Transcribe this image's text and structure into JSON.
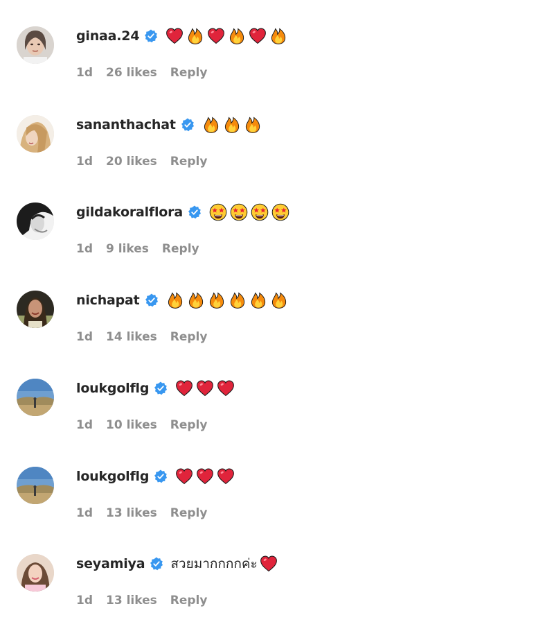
{
  "comments": [
    {
      "username": "ginaa.24",
      "verified": true,
      "content": [
        {
          "type": "emoji",
          "name": "heart"
        },
        {
          "type": "emoji",
          "name": "fire"
        },
        {
          "type": "emoji",
          "name": "heart"
        },
        {
          "type": "emoji",
          "name": "fire"
        },
        {
          "type": "emoji",
          "name": "heart"
        },
        {
          "type": "emoji",
          "name": "fire"
        }
      ],
      "time": "1d",
      "likes": "26 likes",
      "reply": "Reply",
      "avatar": "avatar-woman-light"
    },
    {
      "username": "sananthachat",
      "verified": true,
      "content": [
        {
          "type": "emoji",
          "name": "fire"
        },
        {
          "type": "emoji",
          "name": "fire"
        },
        {
          "type": "emoji",
          "name": "fire"
        }
      ],
      "time": "1d",
      "likes": "20 likes",
      "reply": "Reply",
      "avatar": "avatar-woman-blonde"
    },
    {
      "username": "gildakoralflora",
      "verified": true,
      "content": [
        {
          "type": "emoji",
          "name": "star-struck"
        },
        {
          "type": "emoji",
          "name": "star-struck"
        },
        {
          "type": "emoji",
          "name": "star-struck"
        },
        {
          "type": "emoji",
          "name": "star-struck"
        }
      ],
      "time": "1d",
      "likes": "9 likes",
      "reply": "Reply",
      "avatar": "avatar-bw-portrait"
    },
    {
      "username": "nichapat",
      "verified": true,
      "content": [
        {
          "type": "emoji",
          "name": "fire"
        },
        {
          "type": "emoji",
          "name": "fire"
        },
        {
          "type": "emoji",
          "name": "fire"
        },
        {
          "type": "emoji",
          "name": "fire"
        },
        {
          "type": "emoji",
          "name": "fire"
        },
        {
          "type": "emoji",
          "name": "fire"
        }
      ],
      "time": "1d",
      "likes": "14 likes",
      "reply": "Reply",
      "avatar": "avatar-woman-dark"
    },
    {
      "username": "loukgolflg",
      "verified": true,
      "content": [
        {
          "type": "emoji",
          "name": "heart"
        },
        {
          "type": "emoji",
          "name": "heart"
        },
        {
          "type": "emoji",
          "name": "heart"
        }
      ],
      "time": "1d",
      "likes": "10 likes",
      "reply": "Reply",
      "avatar": "avatar-landscape"
    },
    {
      "username": "loukgolflg",
      "verified": true,
      "content": [
        {
          "type": "emoji",
          "name": "heart"
        },
        {
          "type": "emoji",
          "name": "heart"
        },
        {
          "type": "emoji",
          "name": "heart"
        }
      ],
      "time": "1d",
      "likes": "13 likes",
      "reply": "Reply",
      "avatar": "avatar-landscape"
    },
    {
      "username": "seyamiya",
      "verified": true,
      "content": [
        {
          "type": "text",
          "value": "สวยมากกกกค่ะ"
        },
        {
          "type": "emoji",
          "name": "heart"
        }
      ],
      "time": "1d",
      "likes": "13 likes",
      "reply": "Reply",
      "avatar": "avatar-woman-pink"
    }
  ],
  "colors": {
    "username": "#262626",
    "meta": "#8e8e8e",
    "verified": "#3897f0",
    "heart": "#e0243b",
    "fire": "#f58b0d"
  }
}
